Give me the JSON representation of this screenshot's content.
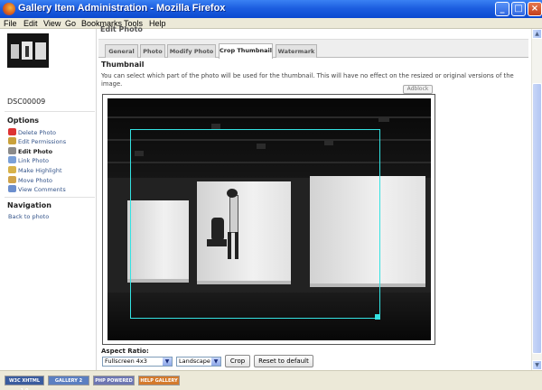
{
  "window": {
    "title": "Gallery Item Administration - Mozilla Firefox"
  },
  "menu": [
    "File",
    "Edit",
    "View",
    "Go",
    "Bookmarks",
    "Tools",
    "Help"
  ],
  "sidebar": {
    "item_name": "DSC00009",
    "options_heading": "Options",
    "options": [
      {
        "label": "Delete Photo",
        "icon": "delete-icon",
        "color": "#d33"
      },
      {
        "label": "Edit Permissions",
        "icon": "permissions-icon",
        "color": "#c9a13b"
      },
      {
        "label": "Edit Photo",
        "icon": "edit-icon",
        "color": "#8a8a8a"
      },
      {
        "label": "Link Photo",
        "icon": "link-icon",
        "color": "#7aa0d8"
      },
      {
        "label": "Make Highlight",
        "icon": "highlight-icon",
        "color": "#d7b24a"
      },
      {
        "label": "Move Photo",
        "icon": "move-icon",
        "color": "#d0a34a"
      },
      {
        "label": "View Comments",
        "icon": "comments-icon",
        "color": "#6c8fce"
      }
    ],
    "navigation_heading": "Navigation",
    "back_link": "Back to photo"
  },
  "main": {
    "page_title": "Edit Photo",
    "tabs": [
      "General",
      "Photo",
      "Modify Photo",
      "Crop Thumbnail",
      "Watermark"
    ],
    "active_tab": "Crop Thumbnail",
    "section_title": "Thumbnail",
    "description": "You can select which part of the photo will be used for the thumbnail. This will have no effect on the resized or original versions of the image.",
    "adblock_label": "Adblock",
    "aspect_ratio_label": "Aspect Ratio:",
    "aspect_ratio_value": "Fullscreen 4x3",
    "orientation_value": "Landscape",
    "crop_button": "Crop",
    "reset_button": "Reset to default"
  },
  "statusbar": {
    "badges": [
      "W3C XHTML 1.0",
      "GALLERY 2",
      "PHP POWERED",
      "HELP GALLERY"
    ]
  }
}
